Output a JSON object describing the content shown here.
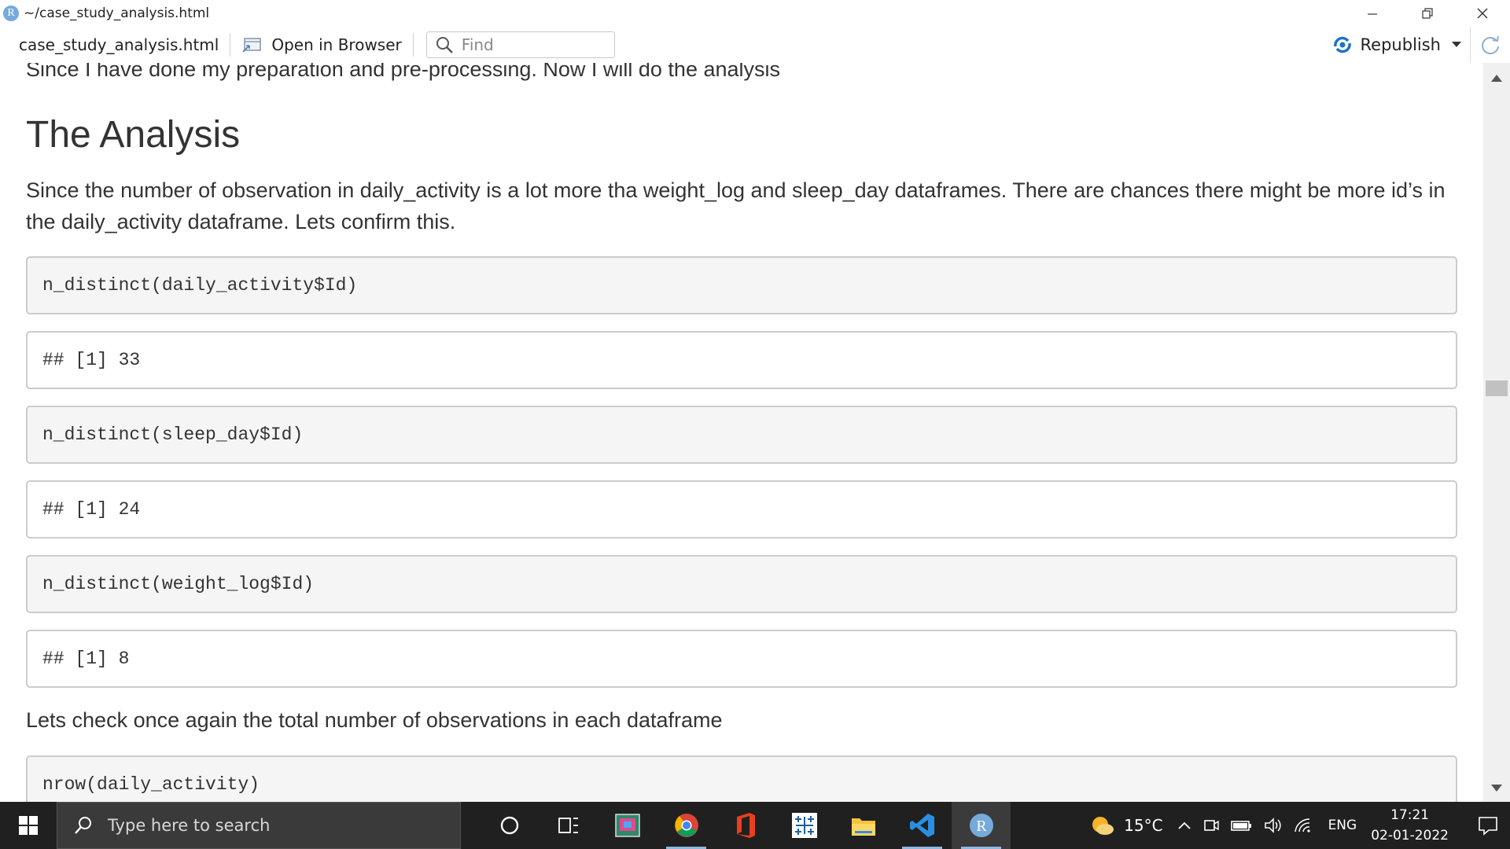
{
  "window": {
    "title": "~/case_study_analysis.html",
    "app_icon_letter": "R"
  },
  "toolbar": {
    "file_tab": "case_study_analysis.html",
    "open_in_browser": "Open in Browser",
    "find_placeholder": "Find",
    "republish": "Republish"
  },
  "document": {
    "intro": "Since I have done my preparation and pre-processing. Now I will do the analysis",
    "heading": "The Analysis",
    "paragraph": "Since the number of observation in daily_activity is a lot more tha weight_log and sleep_day dataframes. There are chances there might be more id’s in the daily_activity dataframe. Lets confirm this.",
    "blocks": [
      {
        "type": "src",
        "text": "n_distinct(daily_activity$Id)"
      },
      {
        "type": "out",
        "text": "## [1] 33"
      },
      {
        "type": "src",
        "text": "n_distinct(sleep_day$Id)"
      },
      {
        "type": "out",
        "text": "## [1] 24"
      },
      {
        "type": "src",
        "text": "n_distinct(weight_log$Id)"
      },
      {
        "type": "out",
        "text": "## [1] 8"
      }
    ],
    "paragraph2": "Lets check once again the total number of observations in each dataframe",
    "partial_code": "nrow(daily_activity)"
  },
  "taskbar": {
    "search_placeholder": "Type here to search",
    "weather_temp": "15°C",
    "language": "ENG",
    "time": "17:21",
    "date": "02-01-2022",
    "r_icon_letter": "R"
  },
  "colors": {
    "accent_blue": "#1a73c8",
    "taskbar_bg": "#202020",
    "code_bg": "#f5f5f5",
    "text": "#333333"
  }
}
